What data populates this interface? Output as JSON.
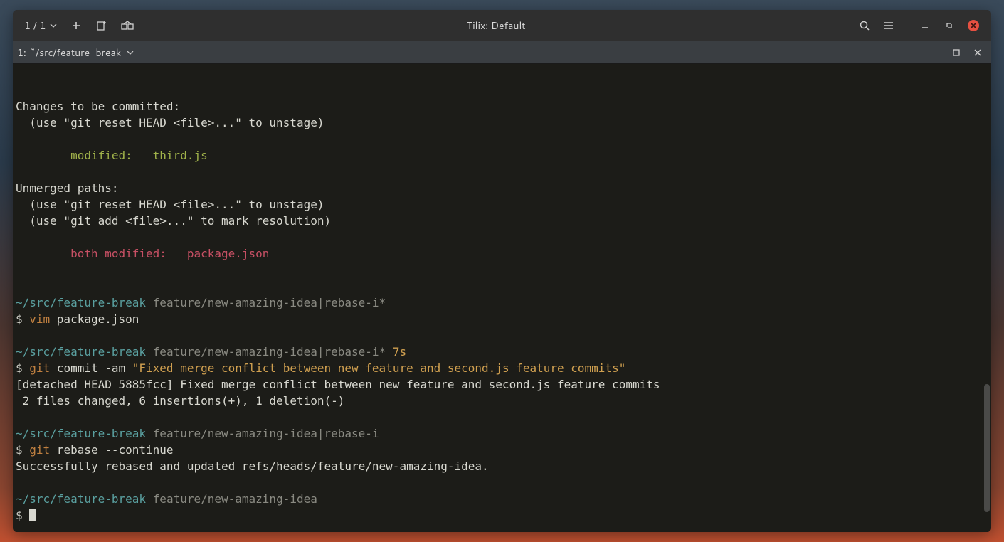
{
  "titlebar": {
    "session_counter": "1 / 1",
    "title": "Tilix: Default"
  },
  "tab": {
    "label": "1: ~/src/feature-break"
  },
  "terminal": {
    "changes_header": "Changes to be committed:",
    "changes_hint": "  (use \"git reset HEAD <file>...\" to unstage)",
    "changes_file": "        modified:   third.js",
    "unmerged_header": "Unmerged paths:",
    "unmerged_hint1": "  (use \"git reset HEAD <file>...\" to unstage)",
    "unmerged_hint2": "  (use \"git add <file>...\" to mark resolution)",
    "unmerged_file": "        both modified:   package.json",
    "cwd": "~/src/feature-break",
    "branch_rebase_dirty": "feature/new-amazing-idea|rebase-i*",
    "branch_rebase_dirty_time": "feature/new-amazing-idea|rebase-i*",
    "time_suffix": " 7s",
    "branch_rebase_clean": "feature/new-amazing-idea|rebase-i",
    "branch_clean": "feature/new-amazing-idea",
    "dollar": "$ ",
    "cmd_vim": "vim ",
    "vim_arg": "package.json",
    "cmd_git1": "git",
    "cmd_commit_args": " commit -am ",
    "commit_msg": "\"Fixed merge conflict between new feature and second.js feature commits\"",
    "commit_out1": "[detached HEAD 5885fcc] Fixed merge conflict between new feature and second.js feature commits",
    "commit_out2": " 2 files changed, 6 insertions(+), 1 deletion(-)",
    "cmd_git2": "git",
    "cmd_rebase_args": " rebase --continue",
    "rebase_out": "Successfully rebased and updated refs/heads/feature/new-amazing-idea."
  }
}
